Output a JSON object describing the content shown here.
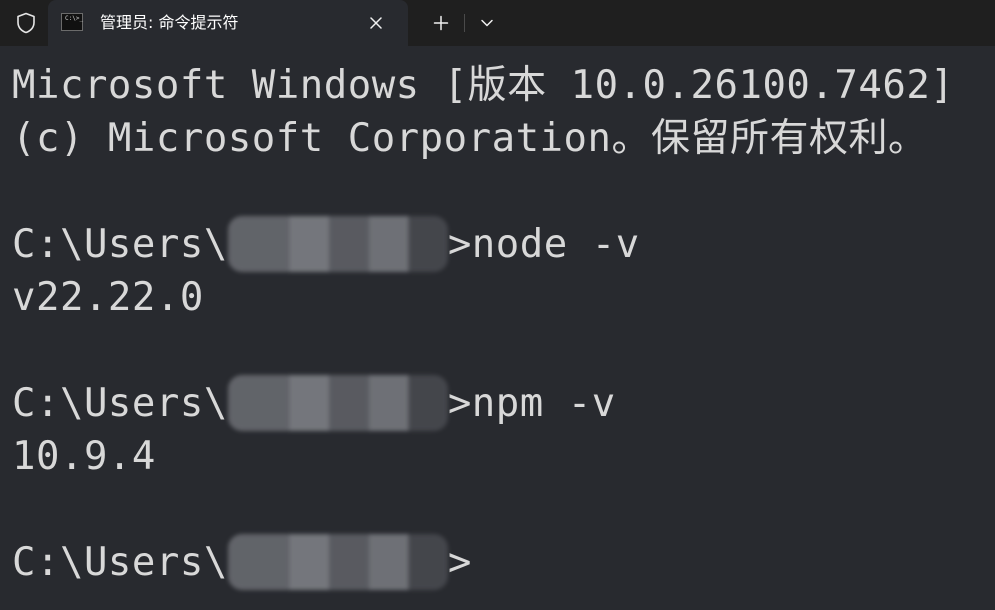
{
  "tab": {
    "icon_text": "C:\\>_",
    "title": "管理员: 命令提示符"
  },
  "icons": {
    "shield": "shield-icon",
    "close": "close-icon",
    "new_tab": "plus-icon",
    "dropdown": "chevron-down-icon",
    "console": "console-icon"
  },
  "terminal": {
    "lines": [
      "Microsoft Windows [版本 10.0.26100.7462]",
      "(c) Microsoft Corporation。保留所有权利。",
      "",
      "C:\\Users\\",
      "v22.22.0",
      "",
      "C:\\Users\\",
      "10.9.4",
      "",
      "C:\\Users\\"
    ],
    "commands": {
      "node": ">node -v",
      "npm": ">npm -v",
      "prompt_end": ">"
    }
  },
  "colors": {
    "background": "#282a2f",
    "tabbar": "#1f1f1f",
    "text": "#d8d8d8"
  }
}
